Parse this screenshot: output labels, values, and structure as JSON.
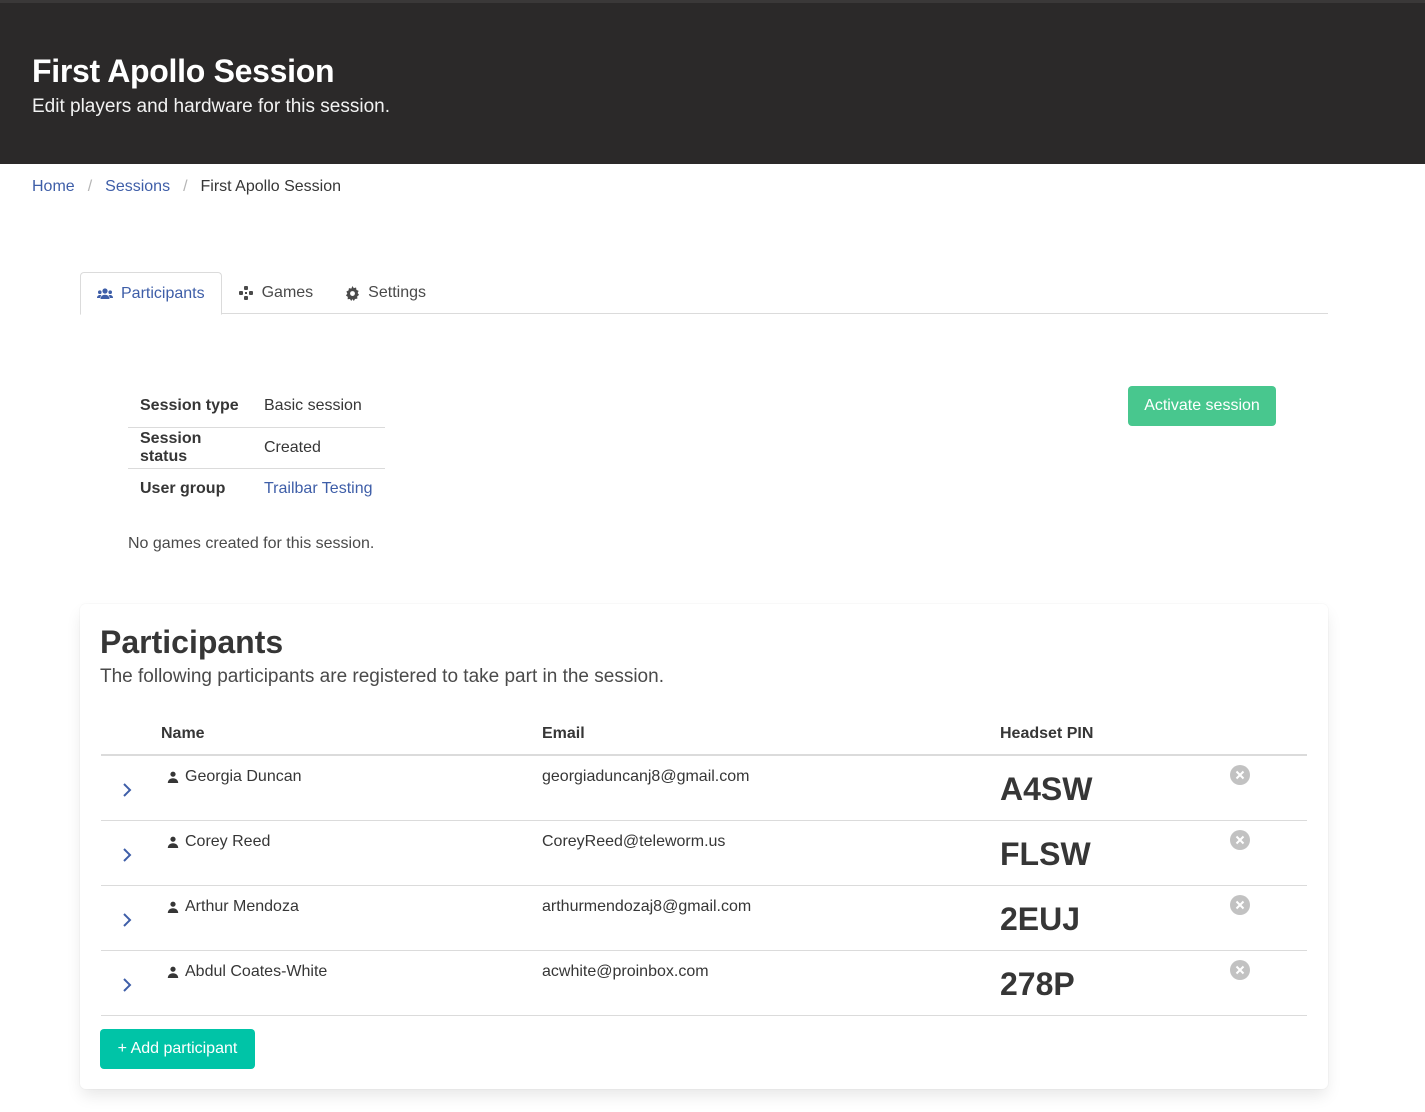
{
  "hero": {
    "title": "First Apollo Session",
    "subtitle": "Edit players and hardware for this session."
  },
  "breadcrumb": {
    "items": [
      "Home",
      "Sessions",
      "First Apollo Session"
    ],
    "separator": "/"
  },
  "tabs": [
    {
      "label": "Participants",
      "icon": "users-icon",
      "active": true
    },
    {
      "label": "Games",
      "icon": "gamepad-icon",
      "active": false
    },
    {
      "label": "Settings",
      "icon": "gear-icon",
      "active": false
    }
  ],
  "session_info": {
    "rows": [
      {
        "key": "Session type",
        "value": "Basic session"
      },
      {
        "key": "Session status",
        "value": "Created"
      },
      {
        "key": "User group",
        "value": "Trailbar Testing"
      }
    ]
  },
  "activate_button": "Activate session",
  "no_games_text": "No games created for this session.",
  "participants": {
    "title": "Participants",
    "subtitle": "The following participants are registered to take part in the session.",
    "columns": [
      "Name",
      "Email",
      "Headset PIN"
    ],
    "rows": [
      {
        "name": "Georgia Duncan",
        "email": "georgiaduncanj8@gmail.com",
        "pin": "A4SW"
      },
      {
        "name": "Corey Reed",
        "email": "CoreyReed@teleworm.us",
        "pin": "FLSW"
      },
      {
        "name": "Arthur Mendoza",
        "email": "arthurmendozaj8@gmail.com",
        "pin": "2EUJ"
      },
      {
        "name": "Abdul Coates-White",
        "email": "acwhite@proinbox.com",
        "pin": "278P"
      }
    ],
    "add_button": "+ Add participant"
  },
  "colors": {
    "hero_bg": "#2b2929",
    "link": "#3e5ea8",
    "activate": "#48c78e",
    "add": "#00c4a7"
  }
}
